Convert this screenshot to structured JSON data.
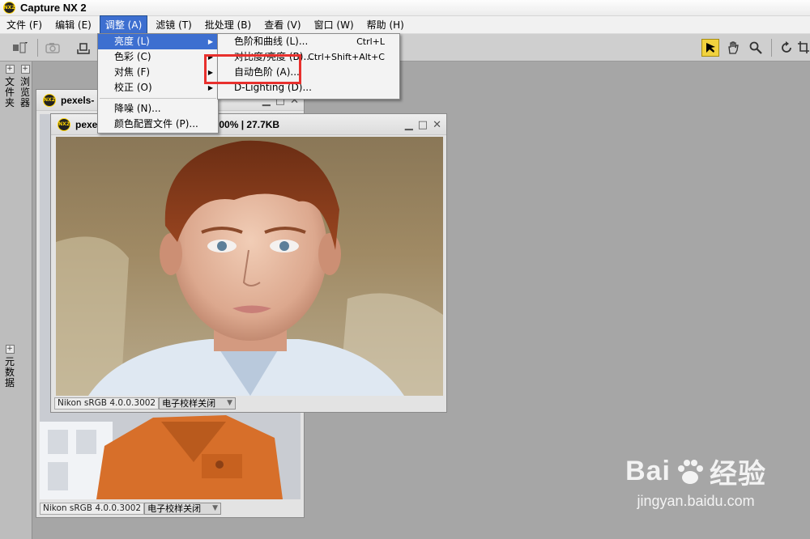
{
  "app": {
    "title": "Capture NX 2",
    "logo_text": "NX2"
  },
  "menubar": [
    {
      "label": "文件 (F)"
    },
    {
      "label": "编辑 (E)"
    },
    {
      "label": "调整 (A)"
    },
    {
      "label": "滤镜 (T)"
    },
    {
      "label": "批处理 (B)"
    },
    {
      "label": "查看 (V)"
    },
    {
      "label": "窗口 (W)"
    },
    {
      "label": "帮助 (H)"
    }
  ],
  "adjust_menu": {
    "items": [
      {
        "label": "亮度 (L)"
      },
      {
        "label": "色彩 (C)"
      },
      {
        "label": "对焦 (F)"
      },
      {
        "label": "校正 (O)"
      },
      {
        "label": "降噪 (N)..."
      },
      {
        "label": "颜色配置文件 (P)..."
      }
    ]
  },
  "brightness_submenu": {
    "items": [
      {
        "label": "色阶和曲线 (L)...",
        "shortcut": "Ctrl+L"
      },
      {
        "label": "对比度/亮度 (B)...",
        "shortcut": "Ctrl+Shift+Alt+C"
      },
      {
        "label": "自动色阶 (A)...",
        "shortcut": ""
      },
      {
        "label": "D-Lighting (D)...",
        "shortcut": ""
      }
    ]
  },
  "left_dock": {
    "folders_label": "文件夹",
    "browser_label": "浏览器",
    "metadata_label": "元数据",
    "plus": "+"
  },
  "back_window": {
    "title": "pexels-",
    "profile": "Nikon sRGB 4.0.0.3002",
    "proof": "电子校样关闭"
  },
  "front_window": {
    "title": "pexe",
    "title_suffix": "00% | 27.7KB",
    "profile": "Nikon sRGB 4.0.0.3002",
    "proof": "电子校样关闭"
  },
  "watermark": {
    "brand": "Bai",
    "brand_suffix": "经验",
    "url": "jingyan.baidu.com"
  },
  "colors": {
    "menu_highlight": "#3d6fd0",
    "annotation_box": "#e8302d",
    "workspace": "#a6a6a6"
  },
  "icons": [
    "camera-icon",
    "print-icon",
    "pointer-icon",
    "hand-icon",
    "zoom-icon",
    "rotate-icon"
  ]
}
